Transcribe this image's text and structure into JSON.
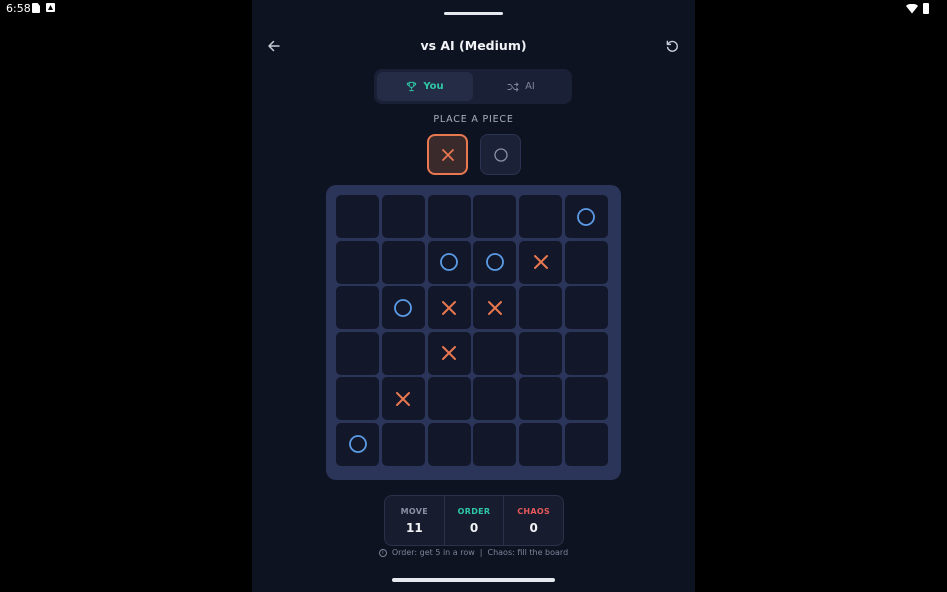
{
  "status_bar": {
    "time": "6:58",
    "left_icons": [
      "document-icon",
      "app-a-icon"
    ],
    "right_icons": [
      "wifi-icon",
      "battery-icon"
    ]
  },
  "header": {
    "title": "vs AI (Medium)",
    "back_icon": "arrow-left-icon",
    "restart_icon": "refresh-icon"
  },
  "turn_tabs": [
    {
      "label": "You",
      "icon": "trophy-icon",
      "active": true
    },
    {
      "label": "AI",
      "icon": "shuffle-icon",
      "active": false
    }
  ],
  "place_label": "PLACE A PIECE",
  "piece_selector": [
    {
      "piece": "X",
      "selected": true
    },
    {
      "piece": "O",
      "selected": false
    }
  ],
  "board": {
    "size": 6,
    "cells": [
      [
        "",
        "",
        "",
        "",
        "",
        "O"
      ],
      [
        "",
        "",
        "O",
        "O",
        "X",
        ""
      ],
      [
        "",
        "O",
        "X",
        "X",
        "",
        ""
      ],
      [
        "",
        "",
        "X",
        "",
        "",
        ""
      ],
      [
        "",
        "X",
        "",
        "",
        "",
        ""
      ],
      [
        "O",
        "",
        "",
        "",
        "",
        ""
      ]
    ]
  },
  "score": {
    "move_label": "MOVE",
    "move_value": "11",
    "order_label": "ORDER",
    "order_value": "0",
    "chaos_label": "CHAOS",
    "chaos_value": "0"
  },
  "hint": {
    "icon": "info-icon",
    "order": "Order: get 5 in a row",
    "separator": "|",
    "chaos": "Chaos: fill the board"
  },
  "colors": {
    "x": "#e8784f",
    "o": "#5b9be6",
    "order": "#2fc7a5",
    "chaos": "#e85a5a",
    "move_label": "#8a8fa3"
  }
}
